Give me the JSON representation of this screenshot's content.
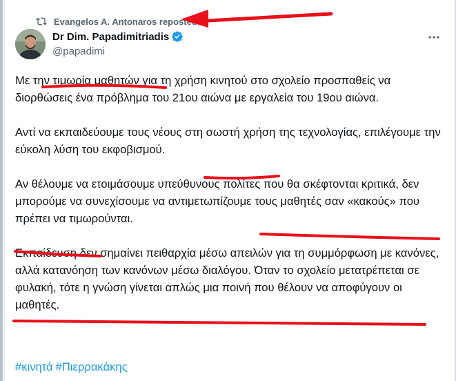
{
  "repost": {
    "text": "Evangelos A. Antonaros reposted",
    "icon": "repost-icon"
  },
  "author": {
    "name": "Dr Dim. Papadimitriadis",
    "handle": "@papadimi",
    "verified": true
  },
  "paragraphs": [
    [
      "Με ",
      {
        "u": "την τιμωρία μαθητών"
      },
      " για τη χρήση κινητού στο σχολείο προσπαθείς να διορθώσεις ένα πρόβλημα του 21ου αιώνα με εργαλεία του 19ου αιώνα."
    ],
    [
      "Αντί να εκπαιδεύουμε τους νέους στη σωστή χρήση της τεχνολογίας, επιλέγουμε την εύκολη λύση του ",
      {
        "u": "εκφοβισμού."
      }
    ],
    [
      "Αν θέλουμε να ετοιμάσουμε υπεύθυνους πολίτες που θα σκέφτονται κριτικά, δεν μπορούμε να συνεχίσουμε να ",
      {
        "u": "αντιμετωπίζουμε τους μαθητές σαν «κακούς»"
      },
      " που πρέπει να τιμωρούνται."
    ],
    [
      "Εκπαίδευση δεν σημαίνει πειθαρχία μέσω απειλών για τη συμμόρφωση με κανόνες, αλλά κατανόηση των κανόνων μέσω διαλόγου. Όταν το ",
      {
        "u": "σχολείο μετατρέπεται σε φυλακή, τότε η γνώση γίνεται απλώς μια ποινή"
      },
      " που θέλουν να αποφύγουν οι μαθητές."
    ]
  ],
  "hashtags": [
    "#κινητά",
    "#Πιερρακάκης"
  ],
  "colors": {
    "text": "#0f1419",
    "muted": "#536471",
    "link": "#1d9bf0",
    "annotation": "#e8101a"
  }
}
